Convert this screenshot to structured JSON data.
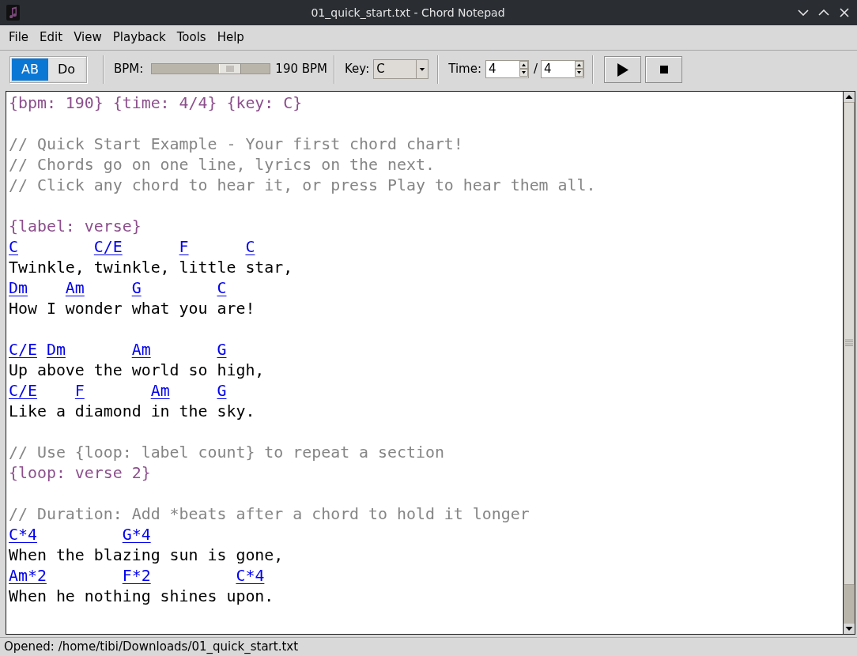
{
  "window": {
    "title": "01_quick_start.txt - Chord Notepad"
  },
  "menu": [
    "File",
    "Edit",
    "View",
    "Playback",
    "Tools",
    "Help"
  ],
  "toolbar": {
    "notation": [
      {
        "label": "AB",
        "selected": true
      },
      {
        "label": "Do",
        "selected": false
      }
    ],
    "bpm": {
      "label": "BPM:",
      "level": 0.71,
      "reading": "190 BPM"
    },
    "key": {
      "label": "Key:",
      "value": "C"
    },
    "time": {
      "label": "Time:",
      "beats": "4",
      "separator": "/",
      "unit": "4"
    }
  },
  "editor": {
    "lines": [
      {
        "kind": "directive",
        "text": "{bpm: 190} {time: 4/4} {key: C}"
      },
      {
        "kind": "blank"
      },
      {
        "kind": "comment",
        "text": "// Quick Start Example - Your first chord chart!"
      },
      {
        "kind": "comment",
        "text": "// Chords go on one line, lyrics on the next."
      },
      {
        "kind": "comment",
        "text": "// Click any chord to hear it, or press Play to hear them all."
      },
      {
        "kind": "blank"
      },
      {
        "kind": "directive",
        "text": "{label: verse}"
      },
      {
        "kind": "chords",
        "text": "C        C/E      F      C"
      },
      {
        "kind": "lyrics",
        "text": "Twinkle, twinkle, little star,"
      },
      {
        "kind": "chords",
        "text": "Dm    Am     G        C"
      },
      {
        "kind": "lyrics",
        "text": "How I wonder what you are!"
      },
      {
        "kind": "blank"
      },
      {
        "kind": "chords",
        "text": "C/E Dm       Am       G"
      },
      {
        "kind": "lyrics",
        "text": "Up above the world so high,"
      },
      {
        "kind": "chords",
        "text": "C/E    F       Am     G"
      },
      {
        "kind": "lyrics",
        "text": "Like a diamond in the sky."
      },
      {
        "kind": "blank"
      },
      {
        "kind": "comment",
        "text": "// Use {loop: label count} to repeat a section"
      },
      {
        "kind": "directive",
        "text": "{loop: verse 2}"
      },
      {
        "kind": "blank"
      },
      {
        "kind": "comment",
        "text": "// Duration: Add *beats after a chord to hold it longer"
      },
      {
        "kind": "chords",
        "text": "C*4         G*4"
      },
      {
        "kind": "lyrics",
        "text": "When the blazing sun is gone,"
      },
      {
        "kind": "chords",
        "text": "Am*2        F*2         C*4"
      },
      {
        "kind": "lyrics",
        "text": "When he nothing shines upon."
      },
      {
        "kind": "blank"
      }
    ]
  },
  "status_bar": "Opened: /home/tibi/Downloads/01_quick_start.txt"
}
